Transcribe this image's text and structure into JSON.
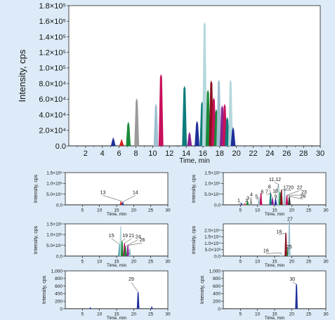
{
  "chart_data": [
    {
      "type": "line",
      "id": "main",
      "xlabel": "Time, min",
      "ylabel": "Intensity, cps",
      "xlim": [
        0,
        30
      ],
      "ylim": [
        0,
        180000
      ],
      "xticks": [
        "2",
        "4",
        "6",
        "8",
        "10",
        "12",
        "14",
        "16",
        "18",
        "20",
        "22",
        "24",
        "26",
        "28",
        "30"
      ],
      "yticks": [
        "0.0",
        "2.0×10⁴",
        "4.0×10⁴",
        "6.0×10⁴",
        "8.0×10⁴",
        "1.0×10⁵",
        "1.2×10⁵",
        "1.4×10⁵",
        "1.6×10⁵",
        "1.8×10⁵"
      ],
      "peaks": [
        {
          "t": 5.3,
          "h": 9000,
          "color": "#1f2f9a"
        },
        {
          "t": 6.3,
          "h": 7000,
          "color": "#d42020"
        },
        {
          "t": 7.1,
          "h": 29000,
          "color": "#1a8a3a"
        },
        {
          "t": 8.1,
          "h": 59000,
          "color": "#9a9a9a"
        },
        {
          "t": 10.4,
          "h": 52000,
          "color": "#9ec0d0"
        },
        {
          "t": 11.0,
          "h": 90000,
          "color": "#c8105a"
        },
        {
          "t": 13.8,
          "h": 75000,
          "color": "#0d7c7c"
        },
        {
          "t": 14.4,
          "h": 16000,
          "color": "#8a2090"
        },
        {
          "t": 15.3,
          "h": 30000,
          "color": "#1f2f9a"
        },
        {
          "t": 15.9,
          "h": 55000,
          "color": "#0d7c7c"
        },
        {
          "t": 16.2,
          "h": 157000,
          "color": "#b5d8dd"
        },
        {
          "t": 16.6,
          "h": 70000,
          "color": "#1a8a3a"
        },
        {
          "t": 17.0,
          "h": 82000,
          "color": "#8a1020"
        },
        {
          "t": 17.3,
          "h": 60000,
          "color": "#c8105a"
        },
        {
          "t": 17.6,
          "h": 45000,
          "color": "#1a8a3a"
        },
        {
          "t": 17.9,
          "h": 83000,
          "color": "#9ec0d0"
        },
        {
          "t": 18.3,
          "h": 50000,
          "color": "#8a2090"
        },
        {
          "t": 18.6,
          "h": 52000,
          "color": "#c8105a"
        },
        {
          "t": 18.9,
          "h": 35000,
          "color": "#0d7c7c"
        },
        {
          "t": 19.3,
          "h": 83000,
          "color": "#b5d8dd"
        },
        {
          "t": 19.6,
          "h": 22000,
          "color": "#1f2f9a"
        }
      ]
    },
    {
      "type": "line",
      "id": "p1",
      "xlabel": "Time, min",
      "ylabel": "Intensity, cps",
      "xlim": [
        0,
        30
      ],
      "ylim": [
        0,
        150000
      ],
      "xticks": [
        "5",
        "10",
        "15",
        "20",
        "25",
        "30"
      ],
      "yticks": [
        "0.0",
        "5.0×10⁴",
        "1.0×10⁵",
        "1.5×10⁵"
      ],
      "peaks": [
        {
          "t": 16.3,
          "h": 18000,
          "color": "#d42020"
        },
        {
          "t": 16.8,
          "h": 14000,
          "color": "#1f2f9a"
        }
      ],
      "annotations": [
        {
          "label": "13",
          "t": 16.3,
          "h": 18000,
          "tx": 11.0,
          "ty": 48000
        },
        {
          "label": "14",
          "t": 16.8,
          "h": 14000,
          "tx": 20.5,
          "ty": 48000
        }
      ]
    },
    {
      "type": "line",
      "id": "p2",
      "xlabel": "Time, min",
      "ylabel": "Intensity, cps",
      "xlim": [
        0,
        30
      ],
      "ylim": [
        0,
        150000
      ],
      "xticks": [
        "5",
        "10",
        "15",
        "20",
        "25",
        "30"
      ],
      "yticks": [
        "0.0",
        "5.0×10⁴",
        "1.0×10⁵",
        "1.5×10⁵"
      ],
      "peaks": [
        {
          "t": 5.3,
          "h": 9000,
          "color": "#1f2f9a"
        },
        {
          "t": 6.3,
          "h": 7000,
          "color": "#d42020"
        },
        {
          "t": 7.1,
          "h": 20000,
          "color": "#1a8a3a"
        },
        {
          "t": 8.1,
          "h": 34000,
          "color": "#9a9a9a"
        },
        {
          "t": 10.4,
          "h": 34000,
          "color": "#9ec0d0"
        },
        {
          "t": 11.0,
          "h": 55000,
          "color": "#c8105a"
        },
        {
          "t": 13.8,
          "h": 55000,
          "color": "#0d7c7c"
        },
        {
          "t": 14.4,
          "h": 32000,
          "color": "#8a2090"
        },
        {
          "t": 15.3,
          "h": 30000,
          "color": "#1f2f9a"
        },
        {
          "t": 16.2,
          "h": 95000,
          "color": "#b5d8dd"
        },
        {
          "t": 16.6,
          "h": 60000,
          "color": "#1a8a3a"
        },
        {
          "t": 17.0,
          "h": 70000,
          "color": "#8a1020"
        },
        {
          "t": 17.9,
          "h": 70000,
          "color": "#9ec0d0"
        },
        {
          "t": 18.6,
          "h": 45000,
          "color": "#c8105a"
        },
        {
          "t": 19.3,
          "h": 40000,
          "color": "#333333"
        }
      ],
      "annotations": [
        {
          "label": "1",
          "t": 5.3,
          "h": 9000,
          "tx": 4.5,
          "ty": 9000
        },
        {
          "label": "2",
          "t": 6.3,
          "h": 7000,
          "tx": 6.8,
          "ty": 9000
        },
        {
          "label": "3",
          "t": 7.1,
          "h": 20000,
          "tx": 7.2,
          "ty": 22000
        },
        {
          "label": "4",
          "t": 8.1,
          "h": 34000,
          "tx": 8.2,
          "ty": 37000
        },
        {
          "label": "5",
          "t": 10.4,
          "h": 34000,
          "tx": 9.7,
          "ty": 28000
        },
        {
          "label": "6",
          "t": 11.0,
          "h": 55000,
          "tx": 11.4,
          "ty": 50000
        },
        {
          "label": "7",
          "t": 13.8,
          "h": 55000,
          "tx": 12.7,
          "ty": 50000
        },
        {
          "label": "8",
          "t": 14.4,
          "h": 32000,
          "tx": 13.5,
          "ty": 73000
        },
        {
          "label": "9",
          "t": 15.3,
          "h": 30000,
          "tx": 15.3,
          "ty": 28000
        },
        {
          "label": "10",
          "t": 16.2,
          "h": 95000,
          "tx": 15.2,
          "ty": 53000
        },
        {
          "label": "11,12",
          "t": 16.2,
          "h": 95000,
          "tx": 15.1,
          "ty": 107000
        },
        {
          "label": "17",
          "t": 17.0,
          "h": 70000,
          "tx": 18.3,
          "ty": 70000
        },
        {
          "label": "20",
          "t": 17.9,
          "h": 70000,
          "tx": 19.8,
          "ty": 70000
        },
        {
          "label": "22",
          "t": 18.6,
          "h": 45000,
          "tx": 22.3,
          "ty": 70000
        },
        {
          "label": "23",
          "t": 18.6,
          "h": 45000,
          "tx": 23.6,
          "ty": 49000
        },
        {
          "label": "28",
          "t": 19.3,
          "h": 40000,
          "tx": 23.3,
          "ty": 30000
        }
      ]
    },
    {
      "type": "line",
      "id": "p3",
      "xlabel": "Time, min",
      "ylabel": "Intensity, cps",
      "xlim": [
        0,
        30
      ],
      "ylim": [
        0,
        150000
      ],
      "xticks": [
        "5",
        "10",
        "15",
        "20",
        "25",
        "30"
      ],
      "yticks": [
        "0.0",
        "5.0×10⁴",
        "1.0×10⁵",
        "1.5×10⁵"
      ],
      "peaks": [
        {
          "t": 15.9,
          "h": 55000,
          "color": "#0d7c7c"
        },
        {
          "t": 16.2,
          "h": 140000,
          "color": "#b5d8dd"
        },
        {
          "t": 16.6,
          "h": 70000,
          "color": "#1a8a3a"
        },
        {
          "t": 17.3,
          "h": 60000,
          "color": "#c8105a"
        },
        {
          "t": 17.6,
          "h": 45000,
          "color": "#1a8a3a"
        },
        {
          "t": 18.3,
          "h": 50000,
          "color": "#8a2090"
        },
        {
          "t": 18.9,
          "h": 35000,
          "color": "#9ec0d0"
        }
      ],
      "annotations": [
        {
          "label": "15",
          "t": 15.9,
          "h": 55000,
          "tx": 13.5,
          "ty": 85000
        },
        {
          "label": "19",
          "t": 16.6,
          "h": 70000,
          "tx": 17.5,
          "ty": 85000
        },
        {
          "label": "21",
          "t": 17.3,
          "h": 60000,
          "tx": 19.4,
          "ty": 85000
        },
        {
          "label": "24",
          "t": 17.6,
          "h": 45000,
          "tx": 21.3,
          "ty": 80000
        },
        {
          "label": "26",
          "t": 18.3,
          "h": 50000,
          "tx": 22.5,
          "ty": 65000
        }
      ]
    },
    {
      "type": "line",
      "id": "p4",
      "xlabel": "Time, min",
      "ylabel": "Intensity, cps",
      "xlim": [
        0,
        30
      ],
      "ylim": [
        0,
        25000
      ],
      "xticks": [
        "5",
        "10",
        "15",
        "20",
        "25",
        "30"
      ],
      "yticks": [
        "0.0",
        "5.0×10³",
        "1.0×10⁴",
        "1.5×10⁴",
        "2.0×10⁴"
      ],
      "peaks": [
        {
          "t": 17.0,
          "h": 2500,
          "color": "#b5d8dd"
        },
        {
          "t": 18.3,
          "h": 18000,
          "color": "#8a1020"
        },
        {
          "t": 18.9,
          "h": 6000,
          "color": "#1a8a3a"
        },
        {
          "t": 19.3,
          "h": 27000,
          "color": "#9ec0d0"
        }
      ],
      "annotations": [
        {
          "label": "16",
          "t": 17.0,
          "h": 2500,
          "tx": 12.5,
          "ty": 2500
        },
        {
          "label": "18",
          "t": 18.3,
          "h": 18000,
          "tx": 16.3,
          "ty": 17000
        },
        {
          "label": "25",
          "t": 18.9,
          "h": 6000,
          "tx": 19.3,
          "ty": 5500
        },
        {
          "label": "27",
          "t": 19.3,
          "h": 27000,
          "tx": 19.5,
          "ty": 27000
        }
      ]
    },
    {
      "type": "line",
      "id": "p5",
      "xlabel": "Time, min",
      "ylabel": "Intensity, cps",
      "xlim": [
        0,
        30
      ],
      "ylim": [
        0,
        1000
      ],
      "xticks": [
        "5",
        "10",
        "15",
        "20",
        "25",
        "30"
      ],
      "yticks": [
        "0",
        "200",
        "400",
        "600",
        "800",
        "1,000"
      ],
      "peaks": [
        {
          "t": 21.3,
          "h": 440,
          "color": "#1f2f9a"
        },
        {
          "t": 7.3,
          "h": 40,
          "color": "#1f2f9a"
        },
        {
          "t": 25.3,
          "h": 60,
          "color": "#1f2f9a"
        }
      ],
      "annotations": [
        {
          "label": "29",
          "t": 21.3,
          "h": 440,
          "tx": 19.3,
          "ty": 720
        }
      ]
    },
    {
      "type": "line",
      "id": "p6",
      "xlabel": "Time, min",
      "ylabel": "Intensity, cps",
      "xlim": [
        0,
        30
      ],
      "ylim": [
        0,
        1000
      ],
      "xticks": [
        "5",
        "10",
        "15",
        "20",
        "25",
        "30"
      ],
      "yticks": [
        "0",
        "200",
        "400",
        "600",
        "800",
        "1,000"
      ],
      "peaks": [
        {
          "t": 21.4,
          "h": 650,
          "color": "#1f2f9a"
        }
      ],
      "annotations": [
        {
          "label": "30",
          "t": 21.4,
          "h": 650,
          "tx": 20.2,
          "ty": 720
        }
      ]
    }
  ]
}
